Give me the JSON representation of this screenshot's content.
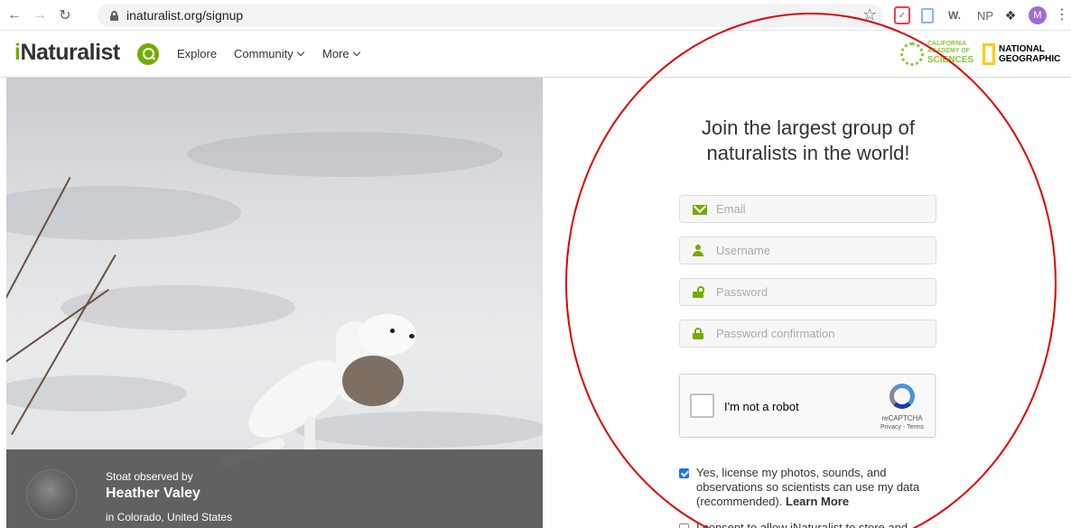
{
  "browser": {
    "url": "inaturalist.org/signup",
    "profile_initial": "M",
    "ext_w": "W.",
    "ext_np": "NP"
  },
  "site": {
    "logo_prefix": "i",
    "logo_rest": "Naturalist",
    "nav": {
      "explore": "Explore",
      "community": "Community",
      "more": "More"
    },
    "partners": {
      "cas_line1": "CALIFORNIA",
      "cas_line2": "ACADEMY OF",
      "cas_line3": "SCIENCES",
      "natgeo_line1": "NATIONAL",
      "natgeo_line2": "GEOGRAPHIC"
    }
  },
  "hero": {
    "observed_label": "Stoat observed by",
    "observer": "Heather Valey",
    "location": "in Colorado, United States"
  },
  "signup": {
    "heading_line1": "Join the largest group of",
    "heading_line2": "naturalists in the world!",
    "email_placeholder": "Email",
    "username_placeholder": "Username",
    "password_placeholder": "Password",
    "password_confirm_placeholder": "Password confirmation",
    "recaptcha_label": "I'm not a robot",
    "recaptcha_brand": "reCAPTCHA",
    "recaptcha_terms": "Privacy - Terms",
    "license_text": "Yes, license my photos, sounds, and observations so scientists can use my data (recommended).",
    "learn_more": "Learn More",
    "consent_text": "I consent to allow iNaturalist to store and"
  },
  "colors": {
    "brand_green": "#74ac00",
    "annotation_red": "#e00000"
  }
}
